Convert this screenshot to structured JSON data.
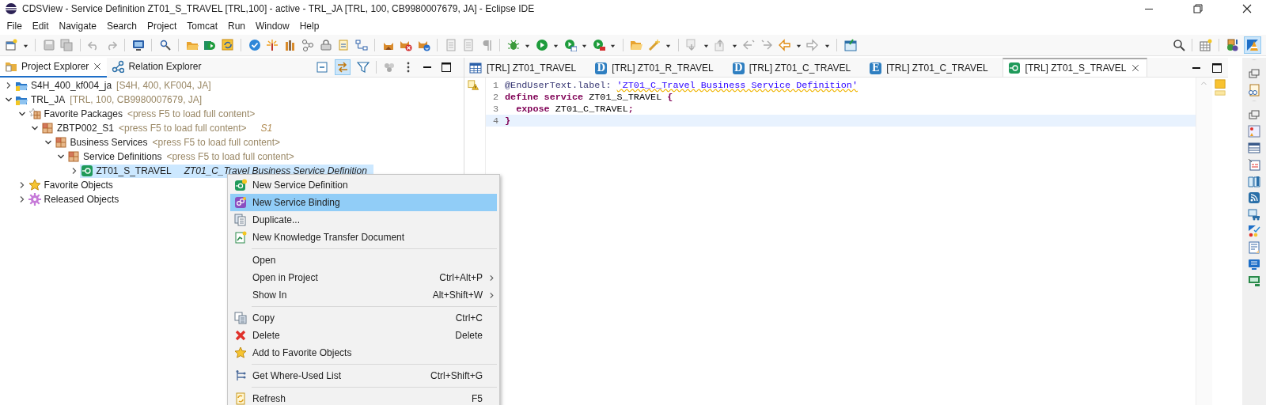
{
  "window": {
    "title": "CDSView - Service Definition ZT01_S_TRAVEL [TRL,100] - active - TRL_JA [TRL, 100, CB9980007679, JA] - Eclipse IDE"
  },
  "menu_bar": [
    "File",
    "Edit",
    "Navigate",
    "Search",
    "Project",
    "Tomcat",
    "Run",
    "Window",
    "Help"
  ],
  "explorer": {
    "tabs": [
      {
        "label": "Project Explorer",
        "selected": true
      },
      {
        "label": "Relation Explorer",
        "selected": false
      }
    ],
    "tree": [
      {
        "kind": "system",
        "label": "S4H_400_kf004_ja",
        "detail": "[S4H, 400, KF004, JA]",
        "expanded": false,
        "selected": false
      },
      {
        "kind": "system",
        "label": "TRL_JA",
        "detail": "[TRL, 100, CB9980007679, JA]",
        "expanded": true,
        "selected": false,
        "children": [
          {
            "kind": "favorites",
            "label": "Favorite Packages",
            "detail": "<press F5 to load full content>",
            "expanded": true,
            "selected": false,
            "children": [
              {
                "kind": "package",
                "label": "ZBTP002_S1",
                "detail": "<press F5 to load full content>",
                "tag": "S1",
                "expanded": true,
                "selected": false,
                "children": [
                  {
                    "kind": "package",
                    "label": "Business Services",
                    "detail": "<press F5 to load full content>",
                    "expanded": true,
                    "selected": false,
                    "children": [
                      {
                        "kind": "package",
                        "label": "Service Definitions",
                        "detail": "<press F5 to load full content>",
                        "expanded": true,
                        "selected": false,
                        "children": [
                          {
                            "kind": "service",
                            "label": "ZT01_S_TRAVEL",
                            "description": "ZT01_C_Travel Business Service Definition",
                            "expanded": false,
                            "selected": true
                          }
                        ]
                      }
                    ]
                  }
                ]
              }
            ]
          },
          {
            "kind": "star",
            "label": "Favorite Objects",
            "expanded": false,
            "selected": false
          },
          {
            "kind": "gear",
            "label": "Released Objects",
            "expanded": false,
            "selected": false
          }
        ]
      }
    ]
  },
  "editor": {
    "tabs": [
      {
        "kind": "table",
        "label": "[TRL] ZT01_TRAVEL",
        "selected": false
      },
      {
        "kind": "badge",
        "badge": "D",
        "label": "[TRL] ZT01_R_TRAVEL",
        "selected": false
      },
      {
        "kind": "badge",
        "badge": "D",
        "label": "[TRL] ZT01_C_TRAVEL",
        "selected": false
      },
      {
        "kind": "badge",
        "badge": "E",
        "label": "[TRL] ZT01_C_TRAVEL",
        "selected": false
      },
      {
        "kind": "service",
        "label": "[TRL] ZT01_S_TRAVEL",
        "selected": true
      }
    ],
    "lines": [
      {
        "number": "1",
        "warning": true,
        "current": false,
        "tokens": [
          {
            "kind": "annotation",
            "text": "@EndUserText.label: "
          },
          {
            "kind": "string",
            "text": "'ZT01_C_Travel Business Service Definition'"
          }
        ]
      },
      {
        "number": "2",
        "warning": false,
        "current": false,
        "tokens": [
          {
            "kind": "keyword",
            "text": "define service "
          },
          {
            "kind": "plain",
            "text": "ZT01_S_TRAVEL "
          },
          {
            "kind": "punct",
            "text": "{"
          }
        ]
      },
      {
        "number": "3",
        "warning": false,
        "current": false,
        "tokens": [
          {
            "kind": "keyword",
            "text": "  expose "
          },
          {
            "kind": "plain",
            "text": "ZT01_C_TRAVEL"
          },
          {
            "kind": "punct",
            "text": ";"
          }
        ]
      },
      {
        "number": "4",
        "warning": false,
        "current": true,
        "tokens": [
          {
            "kind": "punct",
            "text": "}"
          }
        ]
      }
    ]
  },
  "context_menu": [
    {
      "kind": "service-add",
      "label": "New Service Definition",
      "selected": false,
      "submenu": false
    },
    {
      "kind": "binding",
      "label": "New Service Binding",
      "selected": true,
      "submenu": false
    },
    {
      "kind": "duplicate",
      "label": "Duplicate...",
      "selected": false,
      "submenu": false
    },
    {
      "kind": "document-add",
      "label": "New Knowledge Transfer Document",
      "selected": false,
      "submenu": false
    },
    {
      "kind": "separator"
    },
    {
      "kind": "plain",
      "label": "Open",
      "selected": false,
      "submenu": false
    },
    {
      "kind": "plain",
      "label": "Open in Project",
      "shortcut": "Ctrl+Alt+P",
      "selected": false,
      "submenu": true
    },
    {
      "kind": "plain",
      "label": "Show In",
      "shortcut": "Alt+Shift+W",
      "selected": false,
      "submenu": true
    },
    {
      "kind": "separator"
    },
    {
      "kind": "copy",
      "label": "Copy",
      "shortcut": "Ctrl+C",
      "selected": false,
      "submenu": false
    },
    {
      "kind": "delete",
      "label": "Delete",
      "shortcut": "Delete",
      "selected": false,
      "submenu": false
    },
    {
      "kind": "star",
      "label": "Add to Favorite Objects",
      "selected": false,
      "submenu": false
    },
    {
      "kind": "separator"
    },
    {
      "kind": "where-used",
      "label": "Get Where-Used List",
      "shortcut": "Ctrl+Shift+G",
      "selected": false,
      "submenu": false
    },
    {
      "kind": "separator"
    },
    {
      "kind": "refresh",
      "label": "Refresh",
      "shortcut": "F5",
      "selected": false,
      "submenu": false
    }
  ]
}
